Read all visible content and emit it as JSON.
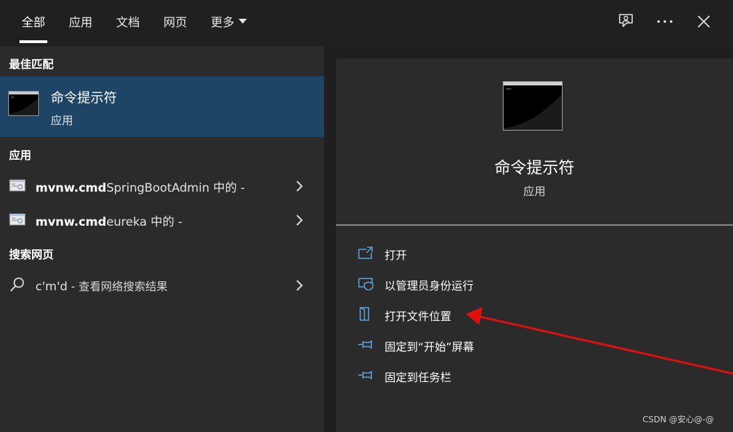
{
  "tabs": [
    {
      "label": "全部",
      "active": true
    },
    {
      "label": "应用",
      "active": false
    },
    {
      "label": "文档",
      "active": false
    },
    {
      "label": "网页",
      "active": false
    },
    {
      "label": "更多",
      "active": false
    }
  ],
  "top_icons": [
    "feedback-icon",
    "more-icon",
    "close-icon"
  ],
  "best_match": {
    "section_title": "最佳匹配",
    "title": "命令提示符",
    "subtitle": "应用",
    "icon": "cmd-icon"
  },
  "apps": {
    "section_title": "应用",
    "items": [
      {
        "strong": "mvnw.cmd",
        "rest": "SpringBootAdmin 中的 -",
        "icon": "script-file-icon"
      },
      {
        "strong": "mvnw.cmd",
        "rest": "eureka 中的 -",
        "icon": "script-file-icon"
      }
    ]
  },
  "web": {
    "section_title": "搜索网页",
    "query": "c'm'd",
    "suffix": " - 查看网络搜索结果",
    "icon": "search-icon"
  },
  "detail": {
    "title": "命令提示符",
    "subtitle": "应用",
    "actions": [
      {
        "label": "打开",
        "icon": "open-icon"
      },
      {
        "label": "以管理员身份运行",
        "icon": "shield-icon"
      },
      {
        "label": "打开文件位置",
        "icon": "folder-location-icon"
      },
      {
        "label": "固定到“开始”屏幕",
        "icon": "pin-icon"
      },
      {
        "label": "固定到任务栏",
        "icon": "pin-icon"
      }
    ]
  },
  "watermark": "CSDN @安心@-@",
  "colors": {
    "selected_bg": "#1f4566",
    "accent_icon": "#5fa8e6",
    "annotation_arrow": "#e01010"
  }
}
